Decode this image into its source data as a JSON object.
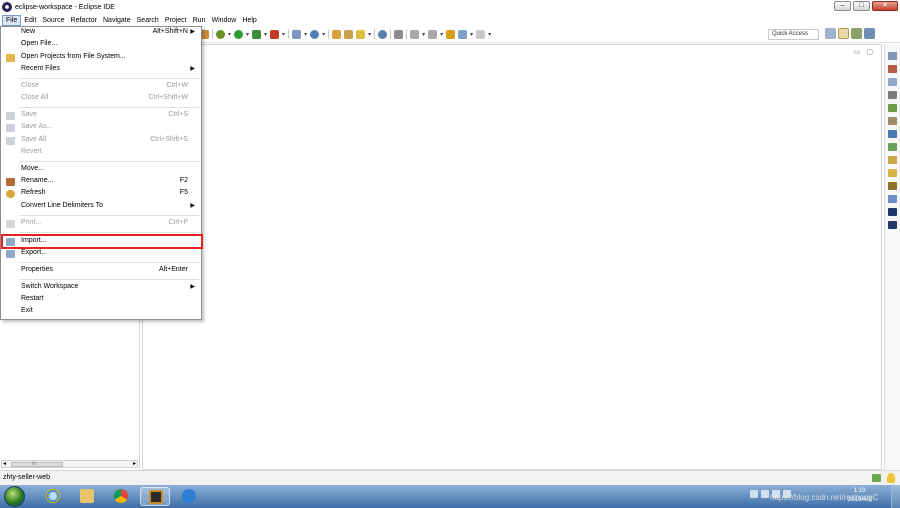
{
  "window": {
    "title": "eclipse-workspace - Eclipse IDE",
    "minimize_label": "–",
    "maximize_label": "□",
    "close_label": "✕"
  },
  "menubar": {
    "items": [
      "File",
      "Edit",
      "Source",
      "Refactor",
      "Navigate",
      "Search",
      "Project",
      "Run",
      "Window",
      "Help"
    ]
  },
  "toolbar": {
    "quick_access_label": "Quick Access"
  },
  "file_menu": {
    "new": {
      "label": "New",
      "shortcut": "Alt+Shift+N"
    },
    "open_file": {
      "label": "Open File..."
    },
    "open_projects": {
      "label": "Open Projects from File System..."
    },
    "recent_files": {
      "label": "Recent Files"
    },
    "close": {
      "label": "Close",
      "shortcut": "Ctrl+W"
    },
    "close_all": {
      "label": "Close All",
      "shortcut": "Ctrl+Shift+W"
    },
    "save": {
      "label": "Save",
      "shortcut": "Ctrl+S"
    },
    "save_as": {
      "label": "Save As..."
    },
    "save_all": {
      "label": "Save All",
      "shortcut": "Ctrl+Shift+S"
    },
    "revert": {
      "label": "Revert"
    },
    "move": {
      "label": "Move..."
    },
    "rename": {
      "label": "Rename...",
      "shortcut": "F2"
    },
    "refresh": {
      "label": "Refresh",
      "shortcut": "F5"
    },
    "convert_line_delimiters": {
      "label": "Convert Line Delimiters To"
    },
    "print": {
      "label": "Print...",
      "shortcut": "Ctrl+P"
    },
    "import": {
      "label": "Import..."
    },
    "export": {
      "label": "Export..."
    },
    "properties": {
      "label": "Properties",
      "shortcut": "Alt+Enter"
    },
    "switch_workspace": {
      "label": "Switch Workspace"
    },
    "restart": {
      "label": "Restart"
    },
    "exit": {
      "label": "Exit"
    }
  },
  "left_panel": {
    "scroll_left": "◂",
    "scroll_grip": "III",
    "scroll_right": "▸"
  },
  "editor": {
    "minimize": "▭",
    "maximize": "▢"
  },
  "statusbar": {
    "text": "zhty-seller-web"
  },
  "taskbar": {
    "time": "1:19",
    "date": "2019/4/2",
    "watermark": "https://blog.csdn.net/rezhongC"
  },
  "colors": {
    "highlight_border": "#e32321",
    "menu_active_bg": "#dbe8f7",
    "taskbar": "#3e6ea6"
  }
}
